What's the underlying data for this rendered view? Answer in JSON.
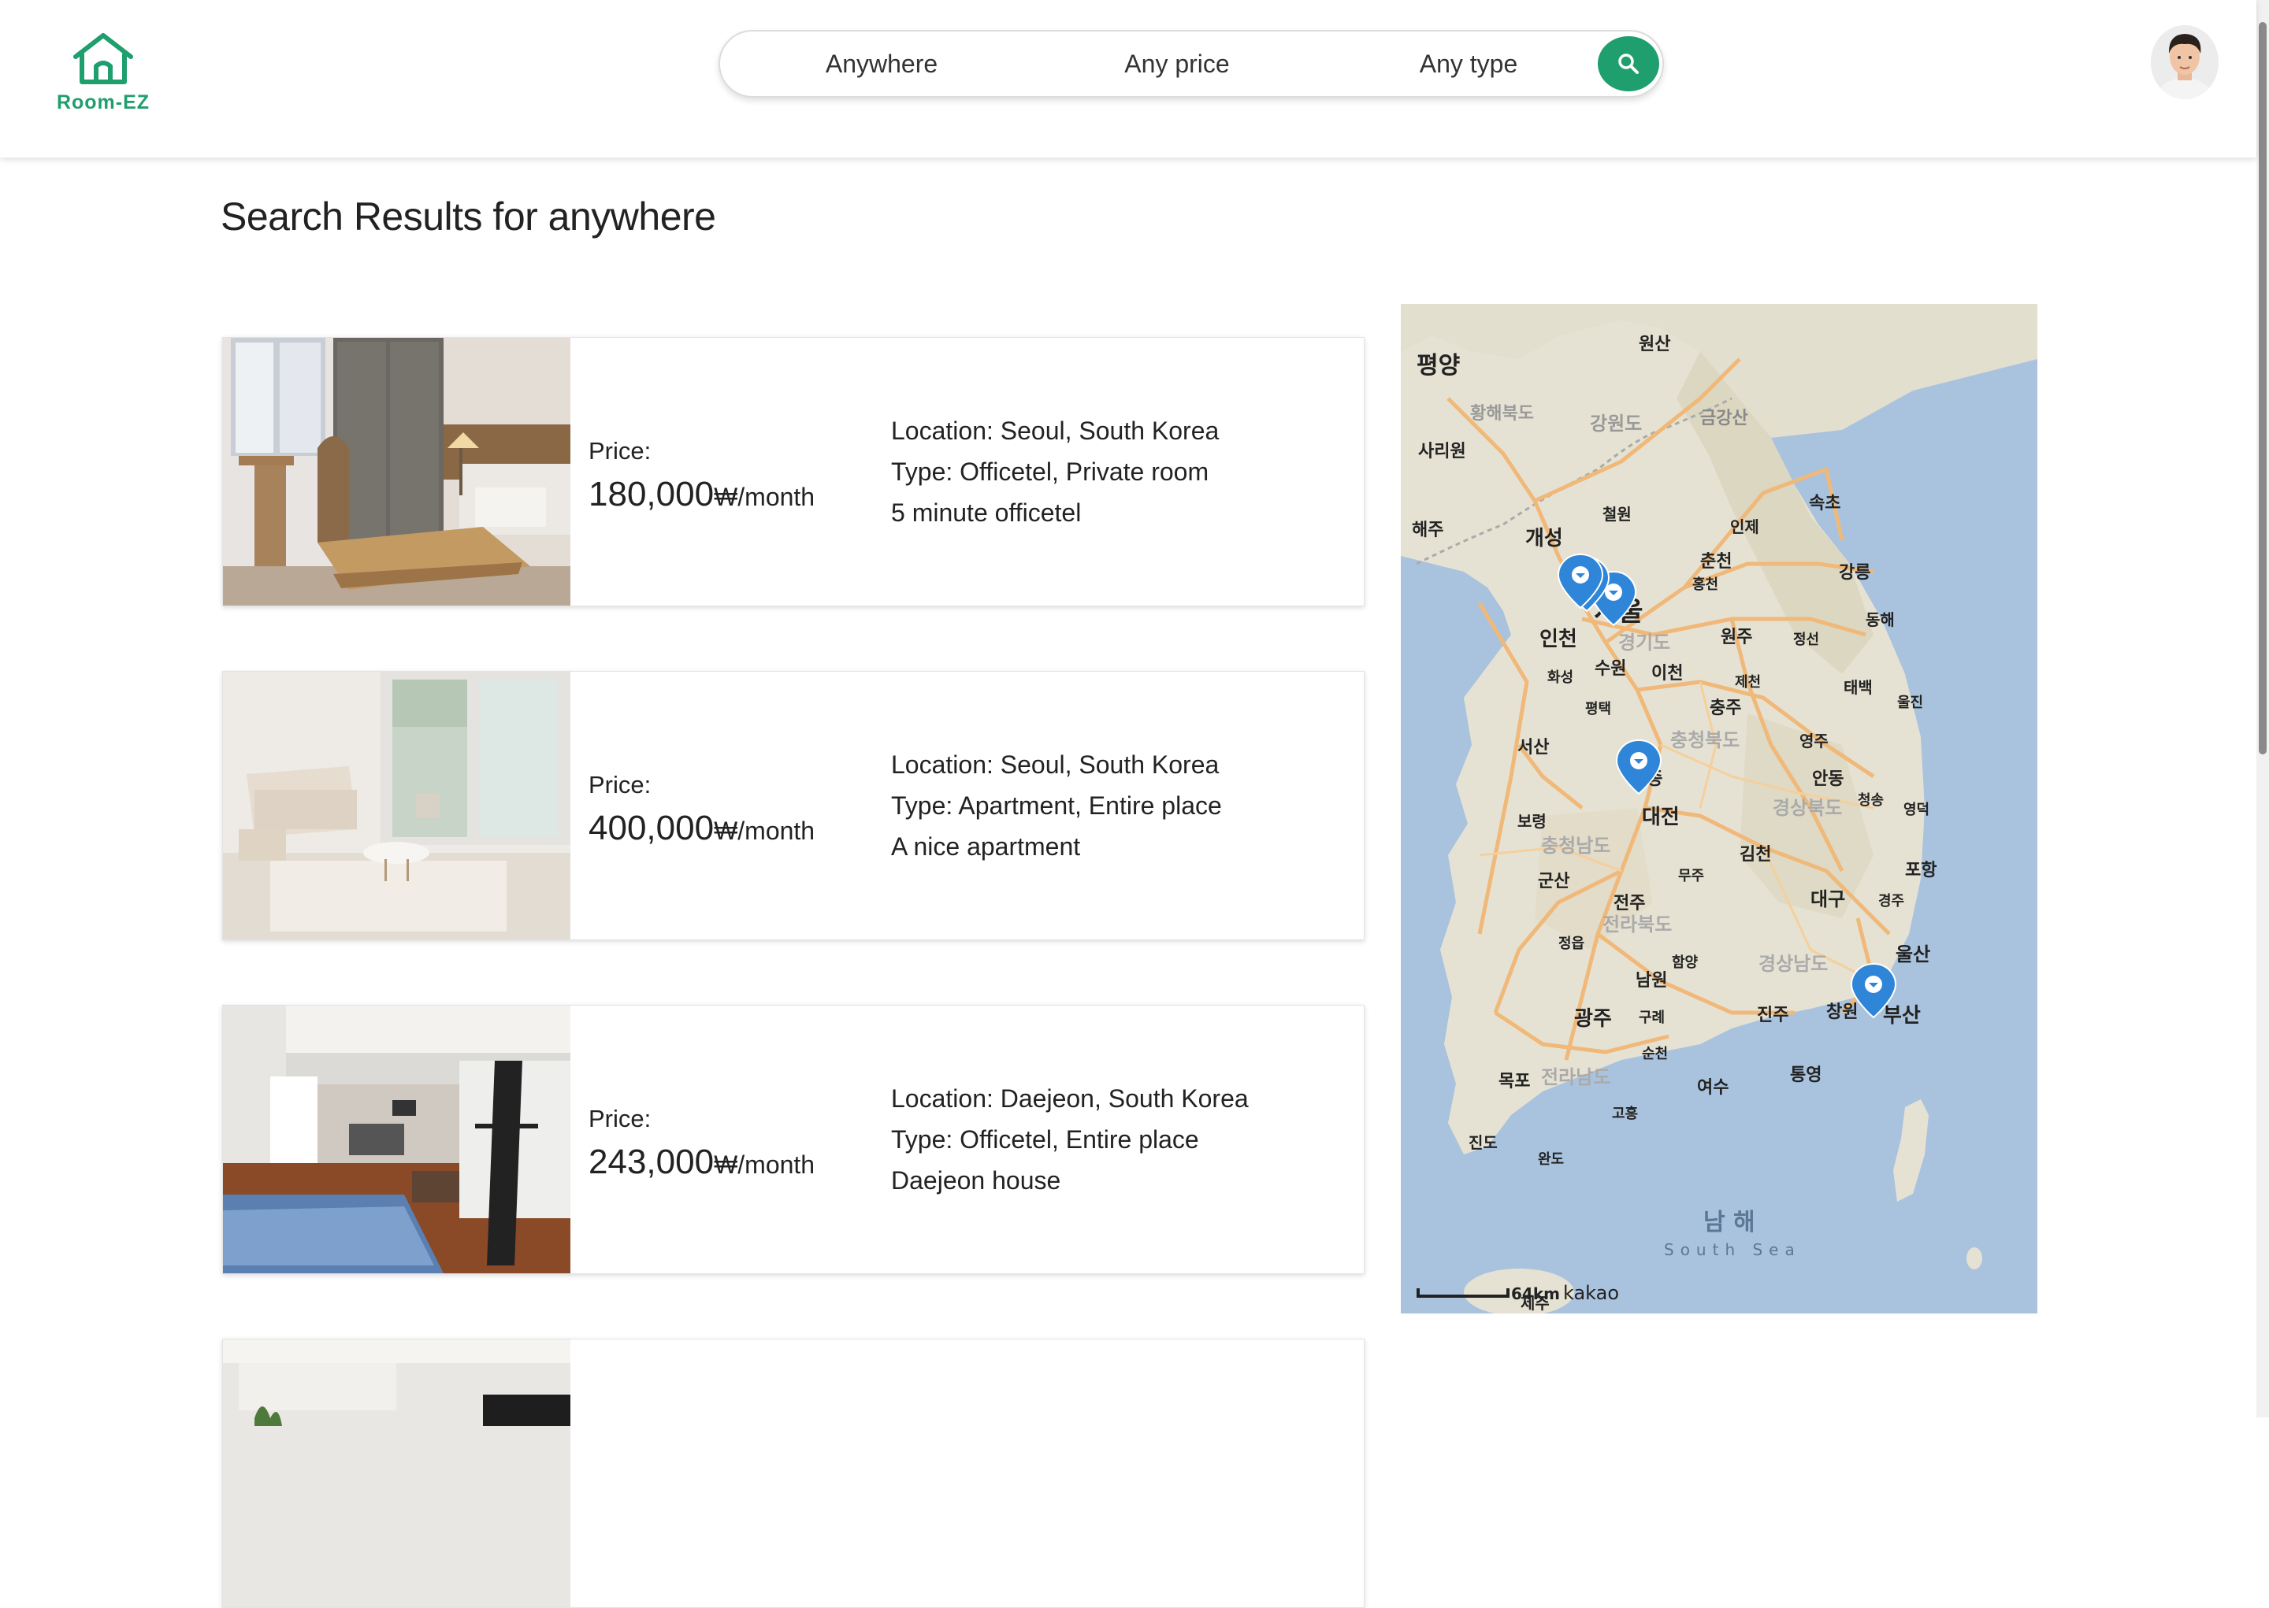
{
  "app": {
    "logo_text": "Room-EZ"
  },
  "search": {
    "location": "Anywhere",
    "price": "Any price",
    "type": "Any type"
  },
  "page": {
    "title": "Search Results for anywhere"
  },
  "listings": [
    {
      "price_label": "Price:",
      "price": "180,000",
      "price_unit": "₩/month",
      "location": "Location: Seoul, South Korea",
      "type": "Type: Officetel, Private room",
      "description": "5 minute officetel"
    },
    {
      "price_label": "Price:",
      "price": "400,000",
      "price_unit": "₩/month",
      "location": "Location: Seoul, South Korea",
      "type": "Type: Apartment, Entire place",
      "description": "A nice apartment"
    },
    {
      "price_label": "Price:",
      "price": "243,000",
      "price_unit": "₩/month",
      "location": "Location: Daejeon, South Korea",
      "type": "Type: Officetel, Entire place",
      "description": "Daejeon house"
    }
  ],
  "map": {
    "city_labels": [
      "평양",
      "원산",
      "황해북도",
      "강원도",
      "금강산",
      "사리원",
      "해주",
      "개성",
      "철원",
      "인제",
      "속초",
      "춘천",
      "홍천",
      "강릉",
      "서울",
      "인천",
      "원주",
      "동해",
      "경기도",
      "수원",
      "이천",
      "정선",
      "화성",
      "평택",
      "제천",
      "충주",
      "태백",
      "울진",
      "서산",
      "충청북도",
      "영주",
      "안동",
      "세종",
      "보령",
      "대전",
      "청송",
      "영덕",
      "충청남도",
      "경상북도",
      "김천",
      "군산",
      "무주",
      "포항",
      "대구",
      "경주",
      "전주",
      "전라북도",
      "정읍",
      "함양",
      "경상남도",
      "울산",
      "남원",
      "광주",
      "구례",
      "진주",
      "창원",
      "부산",
      "순천",
      "목포",
      "전라남도",
      "통영",
      "여수",
      "고흥",
      "진도",
      "완도",
      "남 해",
      "제주"
    ],
    "sea_label": "South Sea",
    "scale_label": "64km",
    "provider": "kakao"
  },
  "colors": {
    "brand": "#1f9e6e",
    "map_marker": "#2f86d8",
    "map_sea": "#a9c3de",
    "map_land": "#e6e2d3"
  }
}
